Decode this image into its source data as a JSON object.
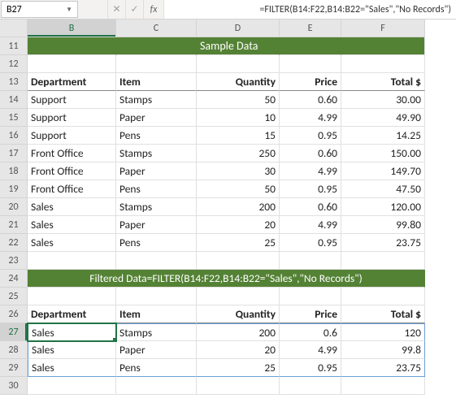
{
  "namebox": {
    "ref": "B27"
  },
  "fxbar": {
    "cancel": "✕",
    "confirm": "✓",
    "fx": "fx"
  },
  "formula": "=FILTER(B14:F22,B14:B22=\"Sales\",\"No Records\")",
  "cols": [
    "B",
    "C",
    "D",
    "E",
    "F"
  ],
  "rows": [
    "11",
    "12",
    "13",
    "14",
    "15",
    "16",
    "17",
    "18",
    "19",
    "20",
    "21",
    "22",
    "23",
    "24",
    "25",
    "26",
    "27",
    "28",
    "29",
    "30"
  ],
  "band1": "Sample Data",
  "band2": "Filtered Data=FILTER(B14:F22,B14:B22=\"Sales\",\"No Records\")",
  "headers": {
    "dept": "Department",
    "item": "Item",
    "qty": "Quantity",
    "price": "Price",
    "total": "Total  $"
  },
  "sample": [
    {
      "dept": "Support",
      "item": "Stamps",
      "qty": "50",
      "price": "0.60",
      "total": "30.00"
    },
    {
      "dept": "Support",
      "item": "Paper",
      "qty": "10",
      "price": "4.99",
      "total": "49.90"
    },
    {
      "dept": "Support",
      "item": "Pens",
      "qty": "15",
      "price": "0.95",
      "total": "14.25"
    },
    {
      "dept": "Front Office",
      "item": "Stamps",
      "qty": "250",
      "price": "0.60",
      "total": "150.00"
    },
    {
      "dept": "Front Office",
      "item": "Paper",
      "qty": "30",
      "price": "4.99",
      "total": "149.70"
    },
    {
      "dept": "Front Office",
      "item": "Pens",
      "qty": "50",
      "price": "0.95",
      "total": "47.50"
    },
    {
      "dept": "Sales",
      "item": "Stamps",
      "qty": "200",
      "price": "0.60",
      "total": "120.00"
    },
    {
      "dept": "Sales",
      "item": "Paper",
      "qty": "20",
      "price": "4.99",
      "total": "99.80"
    },
    {
      "dept": "Sales",
      "item": "Pens",
      "qty": "25",
      "price": "0.95",
      "total": "23.75"
    }
  ],
  "filtered": [
    {
      "dept": "Sales",
      "item": "Stamps",
      "qty": "200",
      "price": "0.6",
      "total": "120"
    },
    {
      "dept": "Sales",
      "item": "Paper",
      "qty": "20",
      "price": "4.99",
      "total": "99.8"
    },
    {
      "dept": "Sales",
      "item": "Pens",
      "qty": "25",
      "price": "0.95",
      "total": "23.75"
    }
  ],
  "chart_data": {
    "type": "table",
    "title": "Sample Data",
    "columns": [
      "Department",
      "Item",
      "Quantity",
      "Price",
      "Total $"
    ],
    "rows": [
      [
        "Support",
        "Stamps",
        50,
        0.6,
        30.0
      ],
      [
        "Support",
        "Paper",
        10,
        4.99,
        49.9
      ],
      [
        "Support",
        "Pens",
        15,
        0.95,
        14.25
      ],
      [
        "Front Office",
        "Stamps",
        250,
        0.6,
        150.0
      ],
      [
        "Front Office",
        "Paper",
        30,
        4.99,
        149.7
      ],
      [
        "Front Office",
        "Pens",
        50,
        0.95,
        47.5
      ],
      [
        "Sales",
        "Stamps",
        200,
        0.6,
        120.0
      ],
      [
        "Sales",
        "Paper",
        20,
        4.99,
        99.8
      ],
      [
        "Sales",
        "Pens",
        25,
        0.95,
        23.75
      ]
    ],
    "filter": {
      "column": "Department",
      "equals": "Sales",
      "formula": "=FILTER(B14:F22,B14:B22=\"Sales\",\"No Records\")"
    },
    "filtered_rows": [
      [
        "Sales",
        "Stamps",
        200,
        0.6,
        120
      ],
      [
        "Sales",
        "Paper",
        20,
        4.99,
        99.8
      ],
      [
        "Sales",
        "Pens",
        25,
        0.95,
        23.75
      ]
    ]
  }
}
